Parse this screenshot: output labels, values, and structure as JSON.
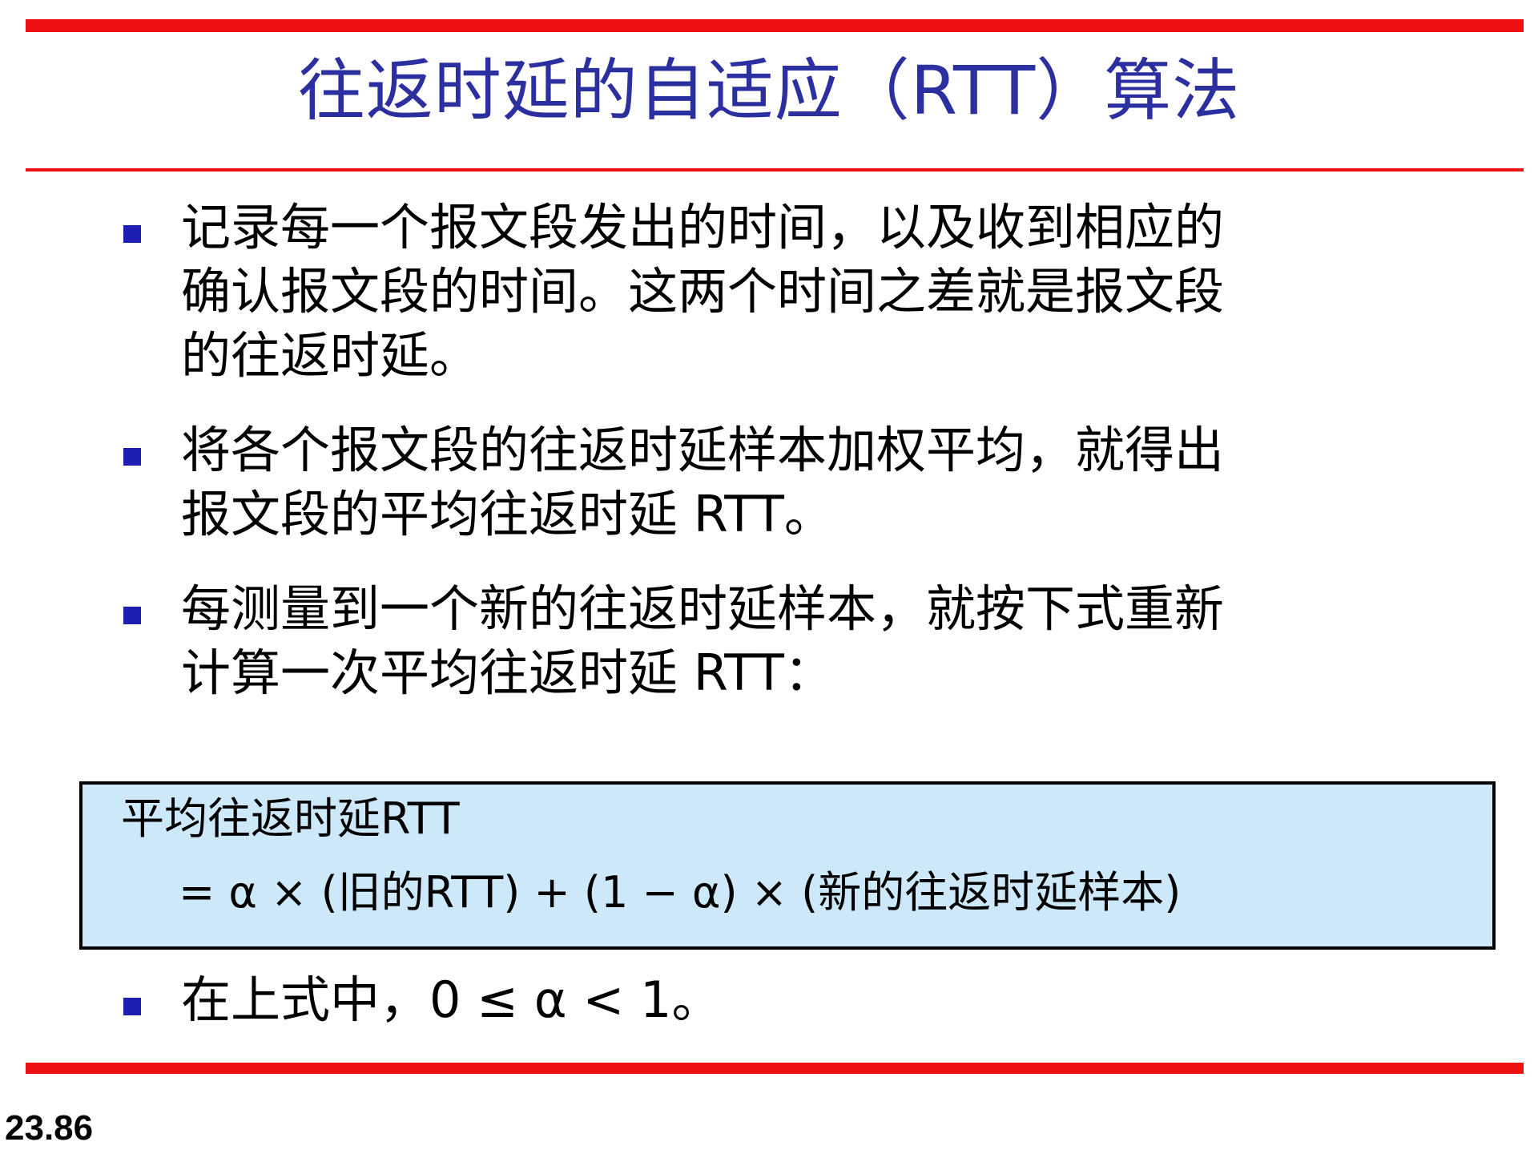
{
  "slide": {
    "title": "往返时延的自适应（RTT）算法",
    "bullets": [
      {
        "lines": [
          "记录每一个报文段发出的时间，以及收到相应的",
          "确认报文段的时间。这两个时间之差就是报文段",
          "的往返时延。"
        ]
      },
      {
        "lines": [
          "将各个报文段的往返时延样本加权平均，就得出",
          "报文段的平均往返时延 RTT。"
        ]
      },
      {
        "lines": [
          "每测量到一个新的往返时延样本，就按下式重新",
          "计算一次平均往返时延 RTT："
        ]
      }
    ],
    "formula": {
      "line1": "平均往返时延RTT",
      "line2": "= α × (旧的RTT) + (1 − α) × (新的往返时延样本)"
    },
    "last_bullet": "在上式中，0 ≤ α < 1。",
    "page_number": "23.86"
  },
  "colors": {
    "title": "#2b2fa0",
    "rule": "#ee1111",
    "bullet_marker": "#1e1eb4",
    "formula_background": "#cde8f8"
  }
}
